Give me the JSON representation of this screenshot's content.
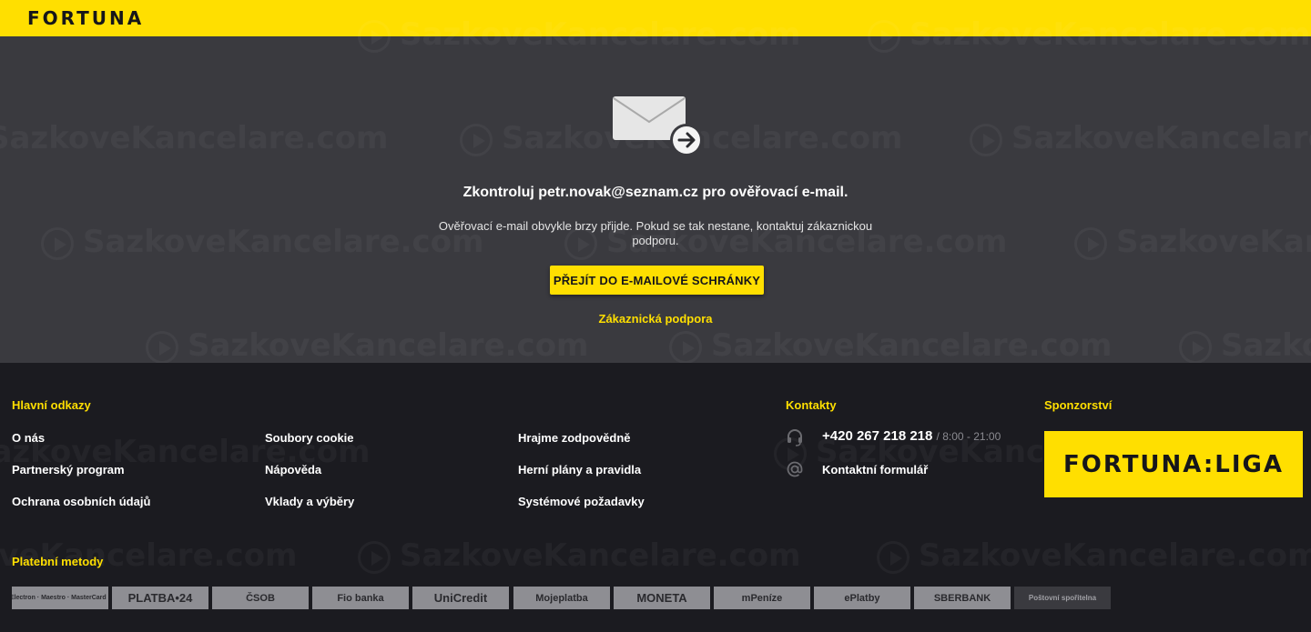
{
  "brand": {
    "logo_text": "FORTUNA",
    "accent_color": "#ffdf00",
    "bg_main": "#3a3a3f",
    "bg_footer": "#1b1b20"
  },
  "watermark": {
    "text": "SazkoveKancelare.com"
  },
  "main": {
    "icon": "mail-arrow-icon",
    "title": "Zkontroluj petr.novak@seznam.cz pro ověřovací e-mail.",
    "text": "Ověřovací e-mail obvykle brzy přijde. Pokud se tak nestane, kontaktuj zákaznickou podporu.",
    "button_label": "PŘEJÍT DO E-MAILOVÉ SCHRÁNKY",
    "support_link": "Zákaznická podpora"
  },
  "footer": {
    "main_links_heading": "Hlavní odkazy",
    "links": {
      "col1": [
        "O nás",
        "Partnerský program",
        "Ochrana osobních údajů"
      ],
      "col2": [
        "Soubory cookie",
        "Nápověda",
        "Vklady a výběry"
      ],
      "col3": [
        "Hrajme zodpovědně",
        "Herní plány a pravidla",
        "Systémové požadavky"
      ]
    },
    "contacts_heading": "Kontakty",
    "phone": "+420 267 218 218",
    "phone_hours": "/ 8:00 - 21:00",
    "contact_form": "Kontaktní formulář",
    "sponsor_heading": "Sponzorství",
    "sponsor_logo_text": "FORTUNA:LIGA",
    "payment_heading": "Platební metody",
    "payment_methods": [
      "VISA Electron · Maestro · MasterCard · VISA",
      "PLATBA•24",
      "ČSOB",
      "Fio banka",
      "UniCredit",
      "Mojeplatba",
      "MONETA",
      "mPeníze",
      "ePlatby",
      "SBERBANK",
      "Poštovní spořitelna"
    ]
  }
}
